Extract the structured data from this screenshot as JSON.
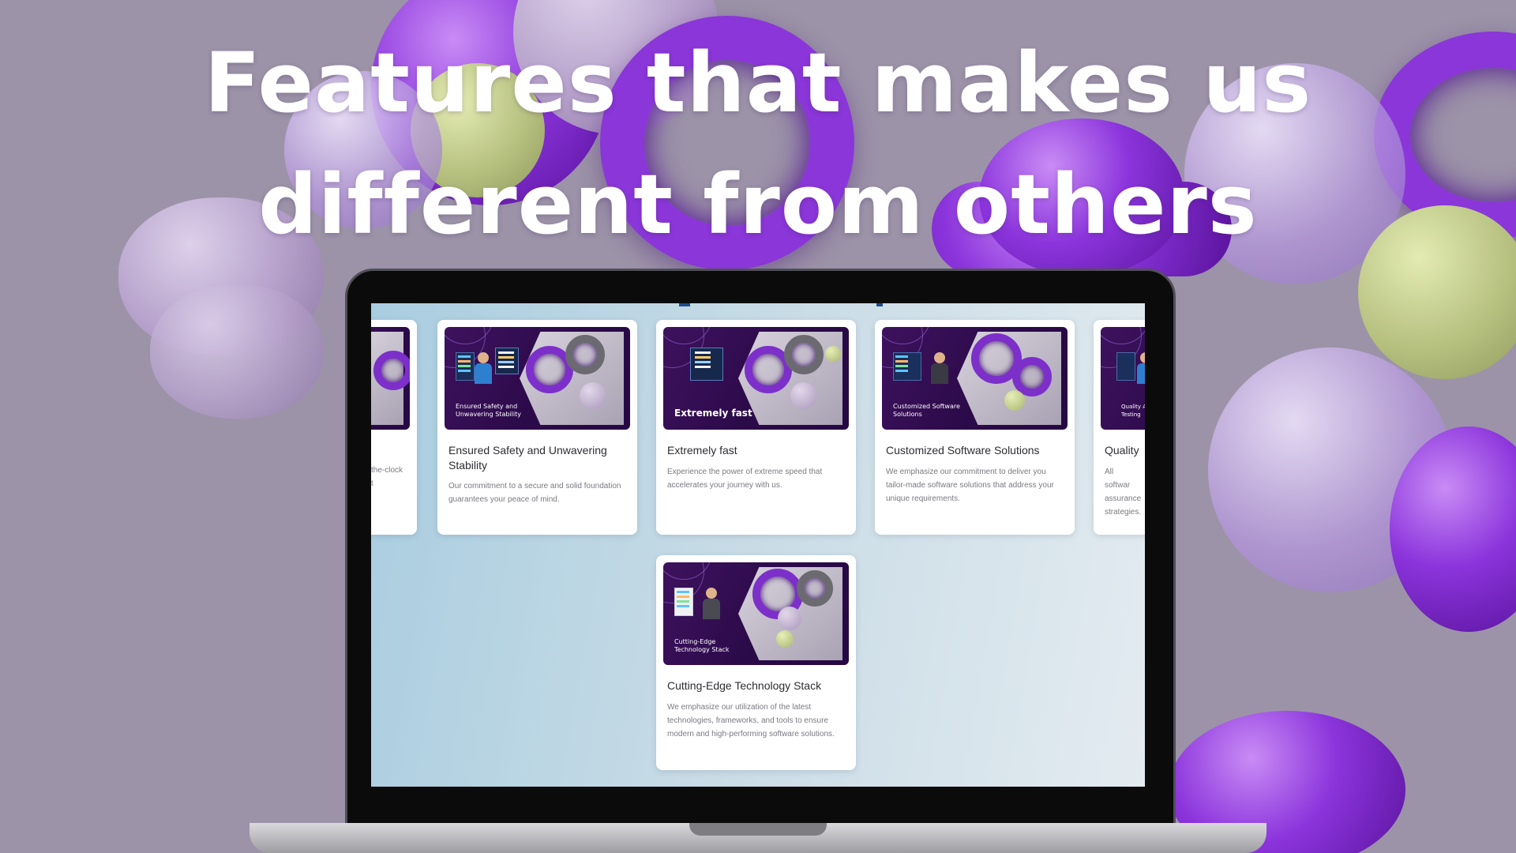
{
  "headline": {
    "line1": "Features that makes us",
    "line2": "different from others"
  },
  "cards": [
    {
      "title": "",
      "description": "the-clock\nt",
      "image_caption": ""
    },
    {
      "title": "Ensured Safety and Unwavering Stability",
      "description": "Our commitment to a secure and solid foundation guarantees your peace of mind.",
      "image_caption": "Ensured Safety and Unwavering Stability"
    },
    {
      "title": "Extremely fast",
      "description": "Experience the power of extreme speed that accelerates your journey with us.",
      "image_caption": "Extremely fast"
    },
    {
      "title": "Customized Software Solutions",
      "description": "We emphasize our commitment to deliver you tailor-made software solutions that address your unique requirements.",
      "image_caption": "Customized Software Solutions"
    },
    {
      "title": "Quality",
      "description": "All softwar assurance strategies.",
      "image_caption": "Quality Ass Testing"
    },
    {
      "title": "Cutting-Edge Technology Stack",
      "description": "We emphasize our utilization of the latest technologies, frameworks, and tools to ensure modern and high-performing software solutions.",
      "image_caption": "Cutting-Edge Technology Stack"
    }
  ],
  "colors": {
    "background": "#9c93a8",
    "accent_purple": "#8b34dc",
    "card_image_bg": "#2a0a48"
  }
}
